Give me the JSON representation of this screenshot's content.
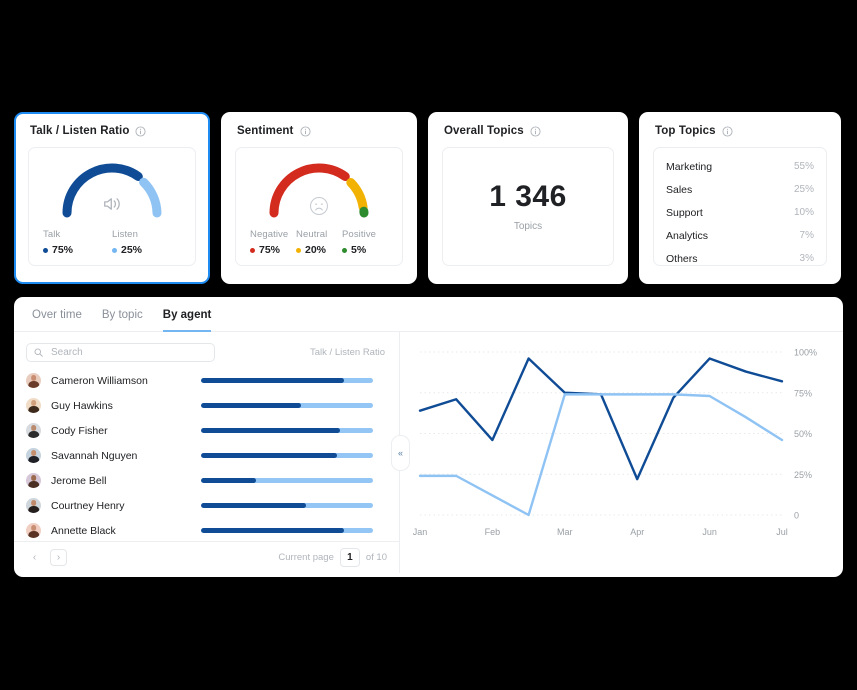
{
  "colors": {
    "accent": "#1d8bf1",
    "dark_blue": "#0f4c95",
    "light_blue": "#93c5f5",
    "negative": "#d32b1e",
    "neutral": "#f2b203",
    "positive": "#2e8b2e",
    "text": "#202124",
    "muted": "#9aa0a6"
  },
  "cards": {
    "talk_listen": {
      "title": "Talk / Listen Ratio",
      "info_icon": "info-icon",
      "center_icon": "speaker-icon",
      "legend": [
        {
          "label": "Talk",
          "value": "75%",
          "pct": 75,
          "color": "#0f4c95"
        },
        {
          "label": "Listen",
          "value": "25%",
          "pct": 25,
          "color": "#74b6f2"
        }
      ]
    },
    "sentiment": {
      "title": "Sentiment",
      "info_icon": "info-icon",
      "center_icon": "sad-face-icon",
      "legend": [
        {
          "label": "Negative",
          "value": "75%",
          "pct": 75,
          "color": "#d32b1e"
        },
        {
          "label": "Neutral",
          "value": "20%",
          "pct": 20,
          "color": "#f2b203"
        },
        {
          "label": "Positive",
          "value": "5%",
          "pct": 5,
          "color": "#2e8b2e"
        }
      ]
    },
    "overall_topics": {
      "title": "Overall Topics",
      "info_icon": "info-icon",
      "value": "1 346",
      "unit": "Topics"
    },
    "top_topics": {
      "title": "Top Topics",
      "info_icon": "info-icon",
      "rows": [
        {
          "name": "Marketing",
          "value": "55%"
        },
        {
          "name": "Sales",
          "value": "25%"
        },
        {
          "name": "Support",
          "value": "10%"
        },
        {
          "name": "Analytics",
          "value": "7%"
        },
        {
          "name": "Others",
          "value": "3%"
        }
      ]
    }
  },
  "panel": {
    "tabs": [
      {
        "label": "Over time",
        "active": false
      },
      {
        "label": "By topic",
        "active": false
      },
      {
        "label": "By agent",
        "active": true
      }
    ],
    "search": {
      "placeholder": "Search",
      "value": "",
      "icon": "search-icon"
    },
    "column_header": "Talk / Listen Ratio",
    "collapse_handle_icon": "chevron-double-left-icon",
    "agents": [
      {
        "name": "Cameron Williamson",
        "talk_pct": 83,
        "skin": "#c98d72",
        "hair": "#6b3b2a",
        "bg": "#e8cdbf"
      },
      {
        "name": "Guy Hawkins",
        "talk_pct": 58,
        "skin": "#d2a07d",
        "hair": "#3e2a1c",
        "bg": "#f0dcc6"
      },
      {
        "name": "Cody Fisher",
        "talk_pct": 81,
        "skin": "#b98a6e",
        "hair": "#2b2b2b",
        "bg": "#d7dade"
      },
      {
        "name": "Savannah Nguyen",
        "talk_pct": 79,
        "skin": "#c58f6e",
        "hair": "#1f1f26",
        "bg": "#c4d3dd"
      },
      {
        "name": "Jerome Bell",
        "talk_pct": 32,
        "skin": "#9c6a4e",
        "hair": "#4a2f22",
        "bg": "#d6c7d8"
      },
      {
        "name": "Courtney Henry",
        "talk_pct": 61,
        "skin": "#c08a6b",
        "hair": "#241e1c",
        "bg": "#cfd6db"
      },
      {
        "name": "Annette Black",
        "talk_pct": 83,
        "skin": "#c98f73",
        "hair": "#5a3324",
        "bg": "#f0cfc2"
      }
    ],
    "pagination": {
      "prev_icon": "chevron-left-icon",
      "next_icon": "chevron-right-icon",
      "label": "Current page",
      "current": "1",
      "suffix": "of 10"
    }
  },
  "chart_data": {
    "type": "line",
    "title": "",
    "xlabel": "",
    "ylabel": "",
    "ylim": [
      0,
      100
    ],
    "grid": true,
    "ytick_labels": [
      "0",
      "25%",
      "50%",
      "75%",
      "100%"
    ],
    "ytick_values": [
      0,
      25,
      50,
      75,
      100
    ],
    "xtick_labels": [
      "Jan",
      "Feb",
      "Mar",
      "Apr",
      "Jun",
      "Jul"
    ],
    "x": [
      0,
      0.5,
      1,
      1.5,
      2,
      2.5,
      3,
      3.5,
      4,
      4.5,
      5
    ],
    "series": [
      {
        "name": "Talk",
        "color": "#0f4c95",
        "values": [
          64,
          71,
          46,
          96,
          75,
          74,
          22,
          72,
          96,
          88,
          82
        ]
      },
      {
        "name": "Listen",
        "color": "#8fc3f4",
        "values": [
          24,
          24,
          12,
          0,
          74,
          74,
          74,
          74,
          73,
          60,
          46
        ]
      }
    ],
    "legend_position": "none"
  }
}
